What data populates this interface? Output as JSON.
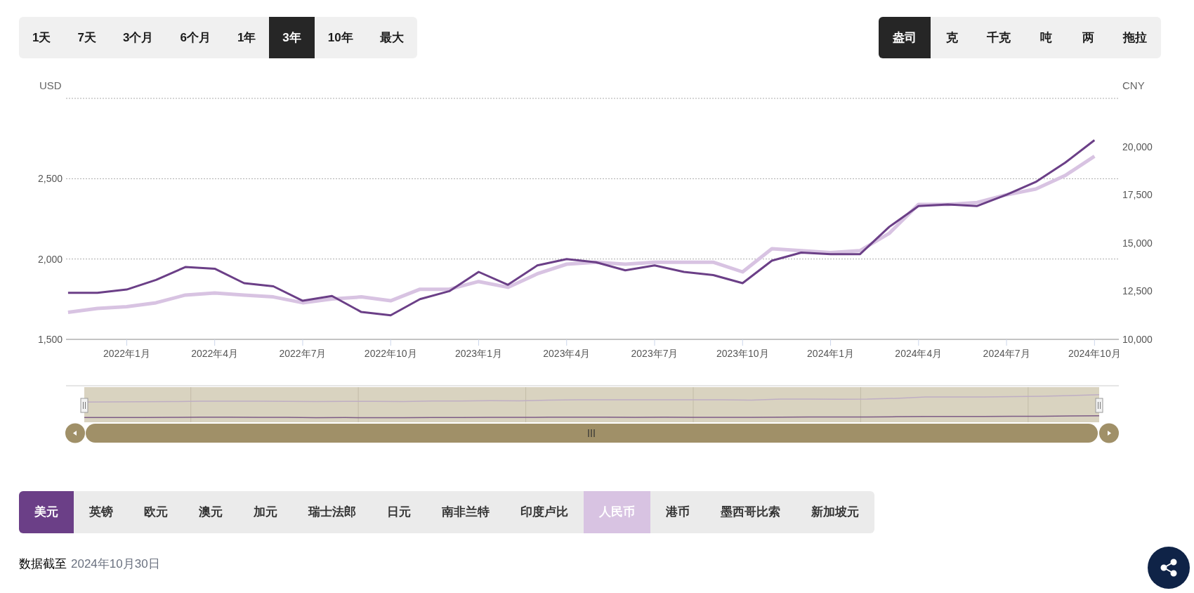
{
  "range_tabs": [
    {
      "label": "1天",
      "selected": false
    },
    {
      "label": "7天",
      "selected": false
    },
    {
      "label": "3个月",
      "selected": false
    },
    {
      "label": "6个月",
      "selected": false
    },
    {
      "label": "1年",
      "selected": false
    },
    {
      "label": "3年",
      "selected": true
    },
    {
      "label": "10年",
      "selected": false
    },
    {
      "label": "最大",
      "selected": false
    }
  ],
  "unit_tabs": [
    {
      "label": "盎司",
      "selected": true
    },
    {
      "label": "克",
      "selected": false
    },
    {
      "label": "千克",
      "selected": false
    },
    {
      "label": "吨",
      "selected": false
    },
    {
      "label": "两",
      "selected": false
    },
    {
      "label": "拖拉",
      "selected": false
    }
  ],
  "chart": {
    "chart_data": {
      "type": "line",
      "ylabel": "USD",
      "y2label": "CNY",
      "categories": [
        null,
        null,
        "2022年1月",
        null,
        null,
        "2022年4月",
        null,
        null,
        "2022年7月",
        null,
        null,
        "2022年10月",
        null,
        null,
        "2023年1月",
        null,
        null,
        "2023年4月",
        null,
        null,
        "2023年7月",
        null,
        null,
        "2023年10月",
        null,
        null,
        "2024年1月",
        null,
        null,
        "2024年4月",
        null,
        null,
        "2024年7月",
        null,
        null,
        "2024年10月"
      ],
      "ylim": [
        1500,
        3000
      ],
      "yticks": [
        {
          "value": 1500,
          "label": "1,500"
        },
        {
          "value": 2000,
          "label": "2,000"
        },
        {
          "value": 2500,
          "label": "2,500"
        }
      ],
      "y2lim": [
        10000,
        22500
      ],
      "y2ticks": [
        {
          "value": 10000,
          "label": "10,000"
        },
        {
          "value": 12500,
          "label": "12,500"
        },
        {
          "value": 15000,
          "label": "15,000"
        },
        {
          "value": 17500,
          "label": "17,500"
        },
        {
          "value": 20000,
          "label": "20,000"
        }
      ],
      "series": [
        {
          "axis": "y2",
          "color": "#d8c3e2",
          "values": [
            11400,
            11600,
            11700,
            11900,
            12300,
            12400,
            12300,
            12200,
            11900,
            12100,
            12200,
            12000,
            12600,
            12600,
            13000,
            12700,
            13400,
            13900,
            14000,
            13900,
            14000,
            14000,
            14000,
            13500,
            14700,
            14600,
            14500,
            14600,
            15500,
            17000,
            17000,
            17100,
            17500,
            17800,
            18500,
            19500
          ]
        },
        {
          "color": "#6b3f87",
          "values": [
            1790,
            1790,
            1810,
            1870,
            1950,
            1940,
            1850,
            1830,
            1740,
            1770,
            1670,
            1650,
            1750,
            1800,
            1920,
            1840,
            1960,
            2000,
            1980,
            1930,
            1960,
            1920,
            1900,
            1850,
            1990,
            2040,
            2030,
            2030,
            2200,
            2330,
            2340,
            2330,
            2400,
            2480,
            2600,
            2740
          ]
        }
      ]
    }
  },
  "currency_tabs": [
    {
      "label": "美元",
      "selected": true,
      "color": "#6b3f87"
    },
    {
      "label": "英镑",
      "selected": false
    },
    {
      "label": "欧元",
      "selected": false
    },
    {
      "label": "澳元",
      "selected": false
    },
    {
      "label": "加元",
      "selected": false
    },
    {
      "label": "瑞士法郎",
      "selected": false
    },
    {
      "label": "日元",
      "selected": false
    },
    {
      "label": "南非兰特",
      "selected": false
    },
    {
      "label": "印度卢比",
      "selected": false
    },
    {
      "label": "人民币",
      "selected": true,
      "color": "#d8c3e2"
    },
    {
      "label": "港币",
      "selected": false
    },
    {
      "label": "墨西哥比索",
      "selected": false
    },
    {
      "label": "新加坡元",
      "selected": false
    }
  ],
  "footer": {
    "label": "数据截至",
    "date": "2024年10月30日"
  }
}
